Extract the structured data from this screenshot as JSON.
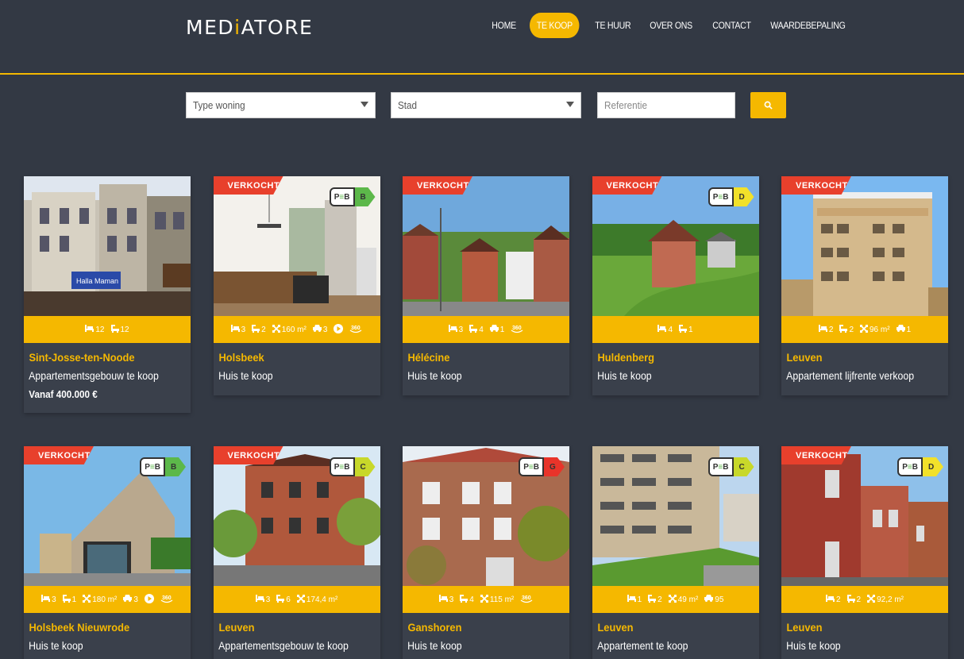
{
  "brand": {
    "logo_pre": "MED",
    "logo_accent": "i",
    "logo_post": "ATORE"
  },
  "nav": [
    "HOME",
    "TE KOOP",
    "TE HUUR",
    "OVER ONS",
    "CONTACT",
    "WAARDEBEPALING"
  ],
  "search": {
    "type_placeholder": "Type woning",
    "city_placeholder": "Stad",
    "ref_placeholder": "Referentie"
  },
  "colors": {
    "accent": "#f5b800",
    "sold": "#e8402c",
    "background": "#333944"
  },
  "listings": [
    {
      "badge": "",
      "epc": "",
      "city": "Sint-Josse-ten-Noode",
      "type": "Appartementsgebouw te koop",
      "price": "Vanaf 400.000 €",
      "features": [
        {
          "icon": "bed-icon",
          "value": "12"
        },
        {
          "icon": "bath-icon",
          "value": "12"
        }
      ]
    },
    {
      "badge": "VERKOCHT",
      "epc": "B",
      "city": "Holsbeek",
      "type": "Huis te koop",
      "price": "",
      "features": [
        {
          "icon": "bed-icon",
          "value": "3"
        },
        {
          "icon": "bath-icon",
          "value": "2"
        },
        {
          "icon": "area-icon",
          "value": "160 m²"
        },
        {
          "icon": "car-icon",
          "value": "3"
        },
        {
          "icon": "video-icon",
          "value": ""
        },
        {
          "icon": "360-icon",
          "value": ""
        }
      ]
    },
    {
      "badge": "VERKOCHT",
      "epc": "",
      "city": "Hélécine",
      "type": "Huis te koop",
      "price": "",
      "features": [
        {
          "icon": "bed-icon",
          "value": "3"
        },
        {
          "icon": "bath-icon",
          "value": "4"
        },
        {
          "icon": "car-icon",
          "value": "1"
        },
        {
          "icon": "360-icon",
          "value": ""
        }
      ]
    },
    {
      "badge": "VERKOCHT",
      "epc": "D",
      "city": "Huldenberg",
      "type": "Huis te koop",
      "price": "",
      "features": [
        {
          "icon": "bed-icon",
          "value": "4"
        },
        {
          "icon": "bath-icon",
          "value": "1"
        }
      ]
    },
    {
      "badge": "VERKOCHT",
      "epc": "",
      "city": "Leuven",
      "type": "Appartement lijfrente verkoop",
      "price": "",
      "features": [
        {
          "icon": "bed-icon",
          "value": "2"
        },
        {
          "icon": "bath-icon",
          "value": "2"
        },
        {
          "icon": "area-icon",
          "value": "96 m²"
        },
        {
          "icon": "car-icon",
          "value": "1"
        }
      ]
    },
    {
      "badge": "VERKOCHT",
      "epc": "B",
      "city": "Holsbeek Nieuwrode",
      "type": "Huis te koop",
      "price": "",
      "features": [
        {
          "icon": "bed-icon",
          "value": "3"
        },
        {
          "icon": "bath-icon",
          "value": "1"
        },
        {
          "icon": "area-icon",
          "value": "180 m²"
        },
        {
          "icon": "car-icon",
          "value": "3"
        },
        {
          "icon": "video-icon",
          "value": ""
        },
        {
          "icon": "360-icon",
          "value": ""
        }
      ]
    },
    {
      "badge": "VERKOCHT",
      "epc": "C",
      "city": "Leuven",
      "type": "Appartementsgebouw te koop",
      "price": "",
      "features": [
        {
          "icon": "bed-icon",
          "value": "3"
        },
        {
          "icon": "bath-icon",
          "value": "6"
        },
        {
          "icon": "area-icon",
          "value": "174,4 m²"
        }
      ]
    },
    {
      "badge": "",
      "epc": "G",
      "city": "Ganshoren",
      "type": "Huis te koop",
      "price": "",
      "features": [
        {
          "icon": "bed-icon",
          "value": "3"
        },
        {
          "icon": "bath-icon",
          "value": "4"
        },
        {
          "icon": "area-icon",
          "value": "115 m²"
        },
        {
          "icon": "360-icon",
          "value": ""
        }
      ]
    },
    {
      "badge": "",
      "epc": "C",
      "city": "Leuven",
      "type": "Appartement te koop",
      "price": "",
      "features": [
        {
          "icon": "bed-icon",
          "value": "1"
        },
        {
          "icon": "bath-icon",
          "value": "2"
        },
        {
          "icon": "area-icon",
          "value": "49 m²"
        },
        {
          "icon": "car-icon",
          "value": "95"
        }
      ]
    },
    {
      "badge": "VERKOCHT",
      "epc": "D",
      "city": "Leuven",
      "type": "Huis te koop",
      "price": "",
      "features": [
        {
          "icon": "bed-icon",
          "value": "2"
        },
        {
          "icon": "bath-icon",
          "value": "2"
        },
        {
          "icon": "area-icon",
          "value": "92,2 m²"
        }
      ]
    }
  ]
}
